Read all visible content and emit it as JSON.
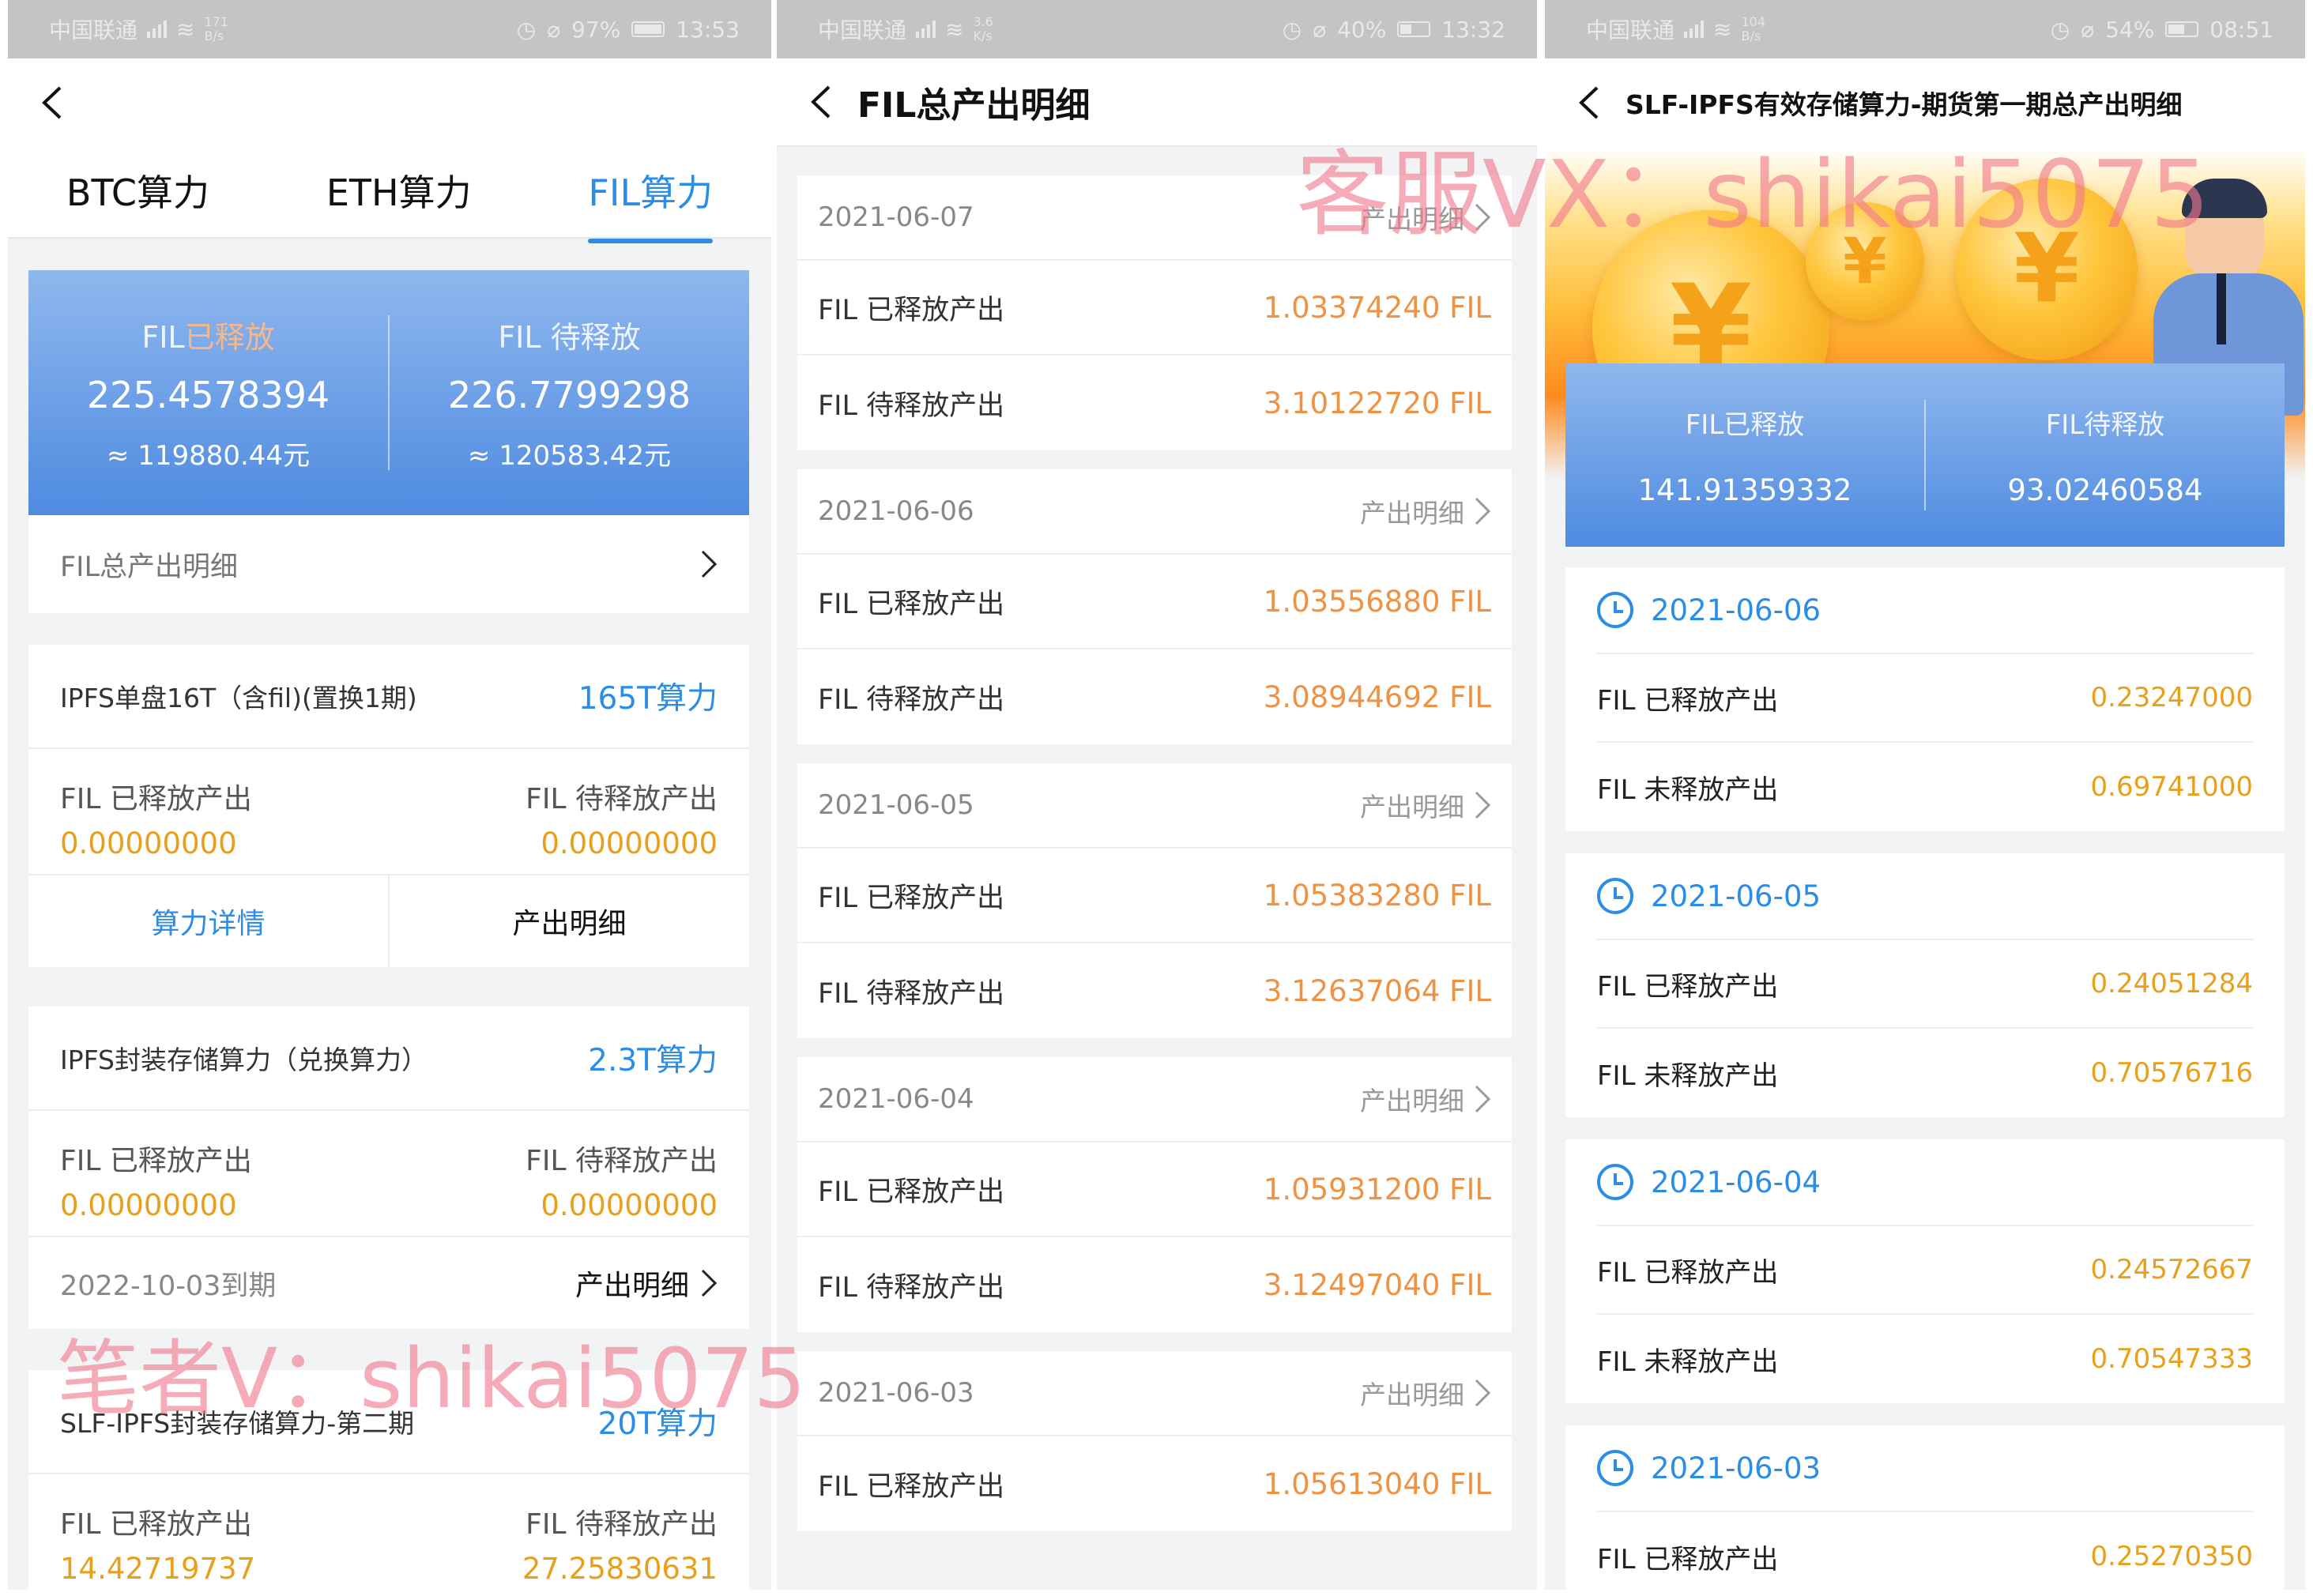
{
  "screens": [
    {
      "status": {
        "carrier": "中国联通",
        "speed": "171\nB/s",
        "battery": "97%",
        "time": "13:53"
      },
      "tabs": [
        "BTC算力",
        "ETH算力",
        "FIL算力"
      ],
      "active_tab": 2,
      "summary": {
        "released_prefix": "FIL",
        "released_label": "已释放",
        "released_value": "225.4578394",
        "released_cny": "≈ 119880.44元",
        "pending_label": "FIL 待释放",
        "pending_value": "226.7799298",
        "pending_cny": "≈ 120583.42元"
      },
      "total_detail_label": "FIL总产出明细",
      "products": [
        {
          "name": "IPFS单盘16T（含fil)(置换1期)",
          "power": "165T算力",
          "released_label": "FIL 已释放产出",
          "released_value": "0.00000000",
          "pending_label": "FIL 待释放产出",
          "pending_value": "0.00000000",
          "action_left": "算力详情",
          "action_right": "产出明细"
        },
        {
          "name": "IPFS封装存储算力（兑换算力）",
          "power": "2.3T算力",
          "released_label": "FIL 已释放产出",
          "released_value": "0.00000000",
          "pending_label": "FIL 待释放产出",
          "pending_value": "0.00000000",
          "expiry": "2022-10-03到期",
          "detail": "产出明细"
        },
        {
          "name": "SLF-IPFS封装存储算力-第二期",
          "power": "20T算力",
          "released_label": "FIL 已释放产出",
          "released_value": "14.42719737",
          "pending_label": "FIL 待释放产出",
          "pending_value": "27.25830631"
        }
      ],
      "watermark": "笔者V：shikai5075"
    },
    {
      "status": {
        "carrier": "中国联通",
        "speed": "3.6\nK/s",
        "battery": "40%",
        "time": "13:32"
      },
      "title": "FIL总产出明细",
      "more_label": "产出明细",
      "days": [
        {
          "date": "2021-06-07",
          "lines": [
            {
              "k": "FIL 已释放产出",
              "v": "1.03374240 FIL"
            },
            {
              "k": "FIL 待释放产出",
              "v": "3.10122720 FIL"
            }
          ]
        },
        {
          "date": "2021-06-06",
          "lines": [
            {
              "k": "FIL 已释放产出",
              "v": "1.03556880 FIL"
            },
            {
              "k": "FIL 待释放产出",
              "v": "3.08944692 FIL"
            }
          ]
        },
        {
          "date": "2021-06-05",
          "lines": [
            {
              "k": "FIL 已释放产出",
              "v": "1.05383280 FIL"
            },
            {
              "k": "FIL 待释放产出",
              "v": "3.12637064 FIL"
            }
          ]
        },
        {
          "date": "2021-06-04",
          "lines": [
            {
              "k": "FIL 已释放产出",
              "v": "1.05931200 FIL"
            },
            {
              "k": "FIL 待释放产出",
              "v": "3.12497040 FIL"
            }
          ]
        },
        {
          "date": "2021-06-03",
          "lines": [
            {
              "k": "FIL 已释放产出",
              "v": "1.05613040 FIL"
            }
          ]
        }
      ]
    },
    {
      "status": {
        "carrier": "中国联通",
        "speed": "104\nB/s",
        "battery": "54%",
        "time": "08:51"
      },
      "title": "SLF-IPFS有效存储算力-期货第一期总产出明细",
      "summary": {
        "released_label": "FIL已释放",
        "released_value": "141.91359332",
        "pending_label": "FIL待释放",
        "pending_value": "93.02460584"
      },
      "coin_glyph": "¥",
      "days": [
        {
          "date": "2021-06-06",
          "lines": [
            {
              "k": "FIL 已释放产出",
              "v": "0.23247000"
            },
            {
              "k": "FIL 未释放产出",
              "v": "0.69741000"
            }
          ]
        },
        {
          "date": "2021-06-05",
          "lines": [
            {
              "k": "FIL 已释放产出",
              "v": "0.24051284"
            },
            {
              "k": "FIL 未释放产出",
              "v": "0.70576716"
            }
          ]
        },
        {
          "date": "2021-06-04",
          "lines": [
            {
              "k": "FIL 已释放产出",
              "v": "0.24572667"
            },
            {
              "k": "FIL 未释放产出",
              "v": "0.70547333"
            }
          ]
        },
        {
          "date": "2021-06-03",
          "lines": [
            {
              "k": "FIL 已释放产出",
              "v": "0.25270350"
            }
          ]
        }
      ],
      "watermark": "客服VX：shikai5075"
    }
  ],
  "colors": {
    "accent_blue": "#2b8de5",
    "value_orange": "#ee9344",
    "value_gold": "#e8a01c",
    "card_gradient_top": "#8fb7ee",
    "card_gradient_bottom": "#4f8be0",
    "watermark": "#f0788c"
  },
  "icons": [
    "back-arrow-icon",
    "chevron-right-icon",
    "clock-icon",
    "signal-icon",
    "wifi-icon",
    "alarm-icon",
    "mute-icon",
    "battery-icon"
  ]
}
